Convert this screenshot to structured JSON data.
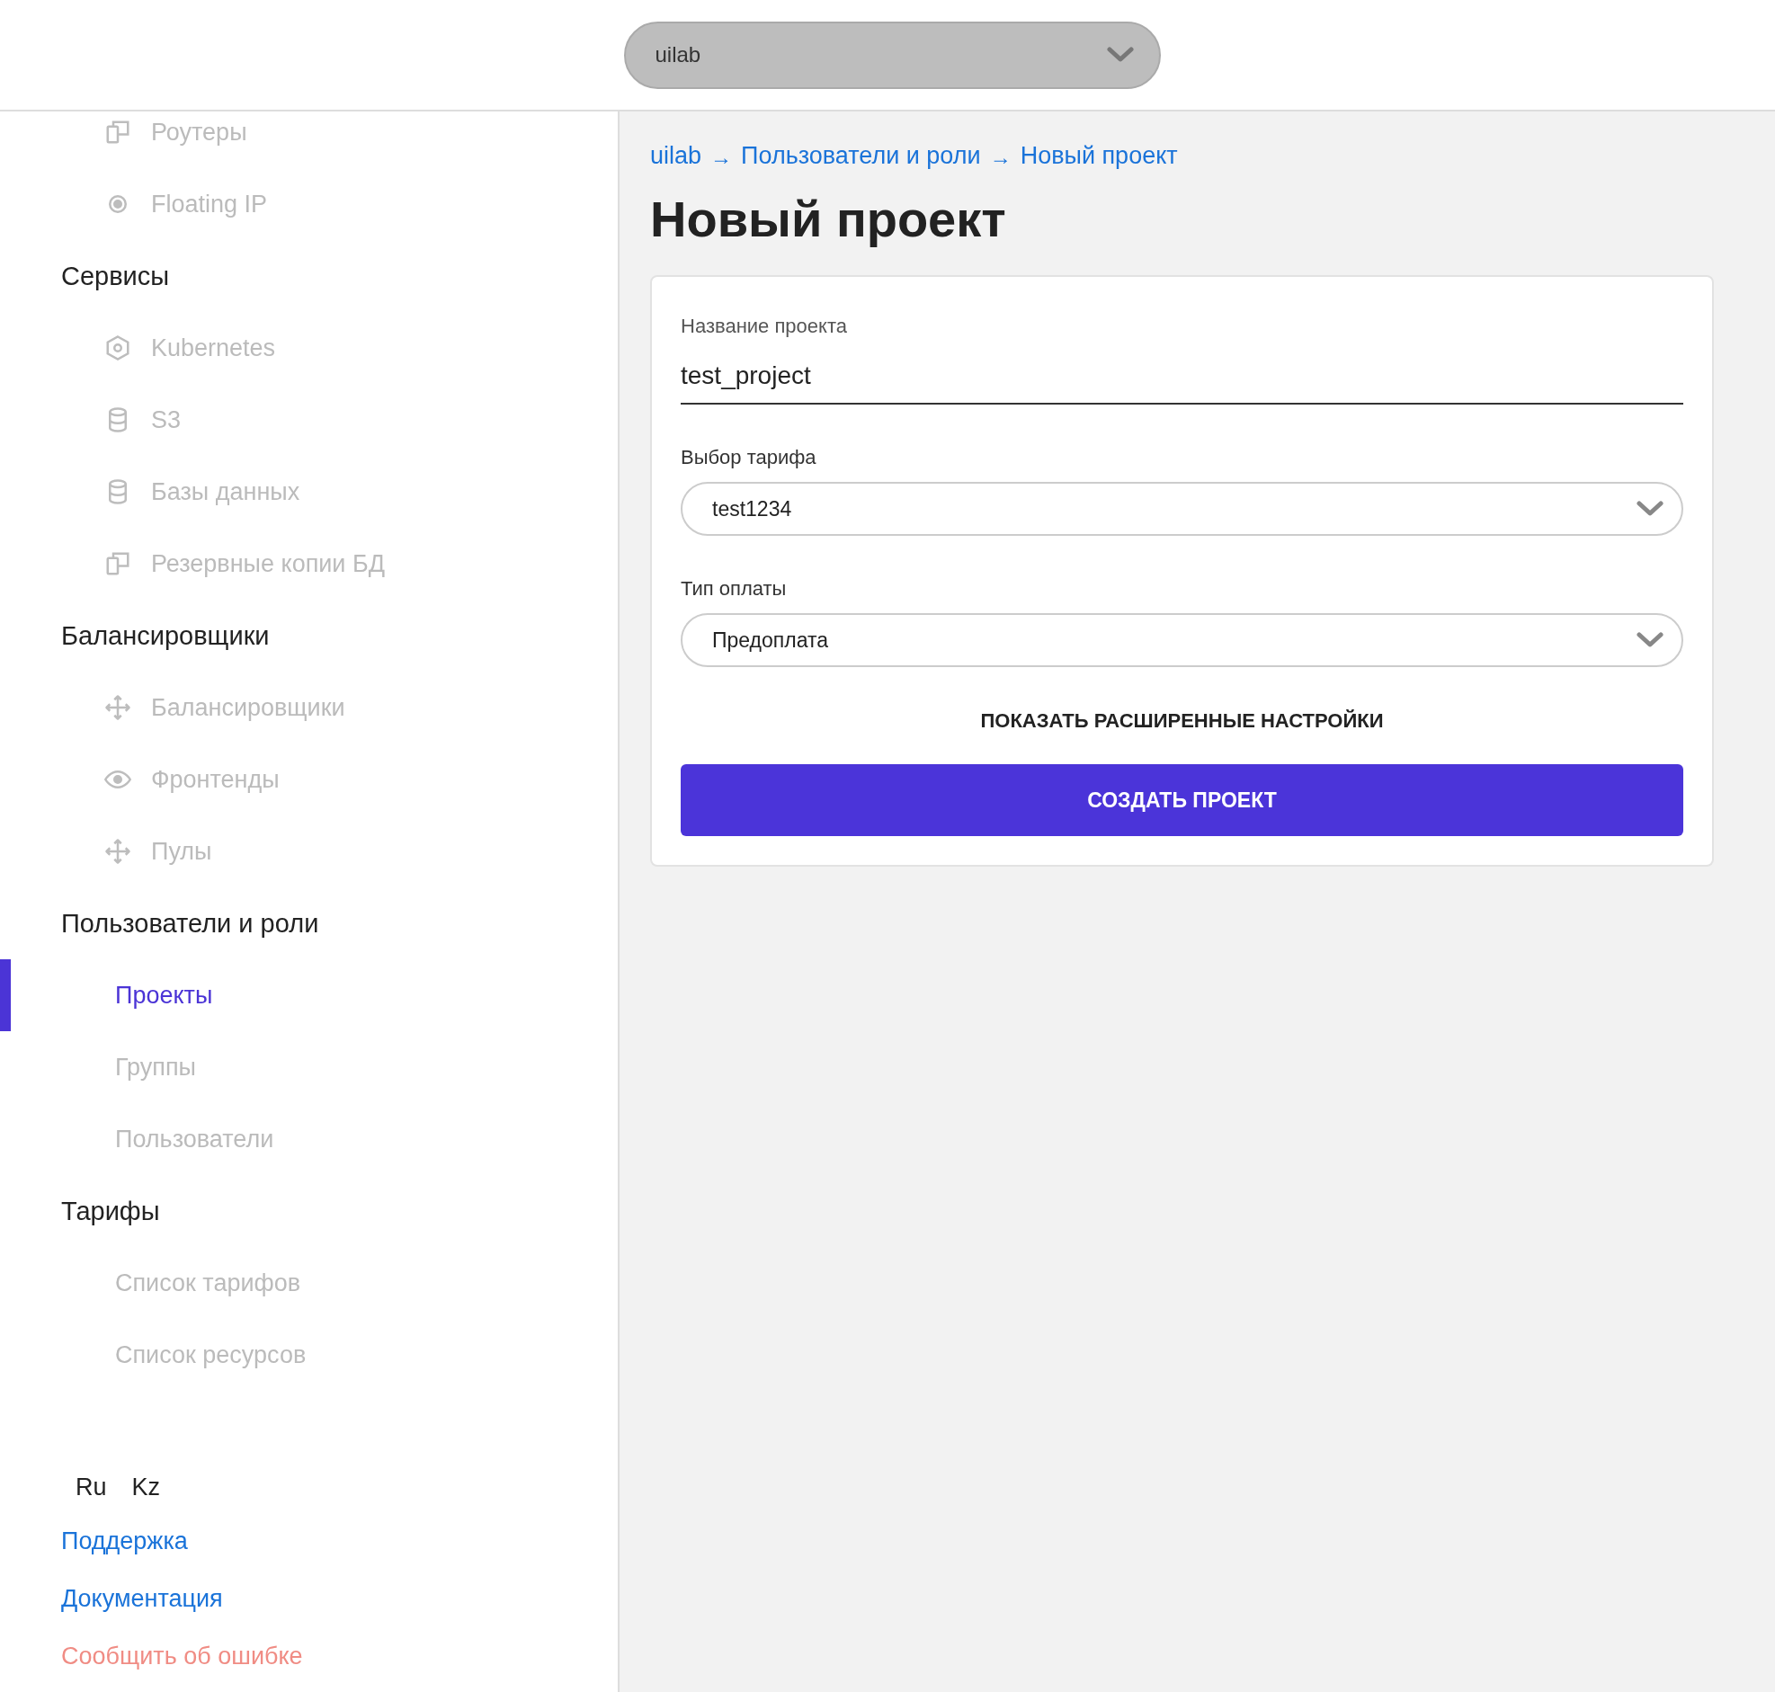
{
  "header": {
    "project_select": {
      "value": "uilab"
    }
  },
  "sidebar": {
    "sections": [
      {
        "items": [
          {
            "label": "Роутеры",
            "kind": "copy",
            "selected": false
          },
          {
            "label": "Floating IP",
            "kind": "target",
            "selected": false
          }
        ]
      },
      {
        "heading": "Сервисы",
        "items": [
          {
            "label": "Kubernetes",
            "kind": "hexagon",
            "selected": false
          },
          {
            "label": "S3",
            "kind": "database",
            "selected": false
          },
          {
            "label": "Базы данных",
            "kind": "database",
            "selected": false
          },
          {
            "label": "Резервные копии БД",
            "kind": "copy",
            "selected": false
          }
        ]
      },
      {
        "heading": "Балансировщики",
        "items": [
          {
            "label": "Балансировщики",
            "kind": "move",
            "selected": false
          },
          {
            "label": "Фронтенды",
            "kind": "eye",
            "selected": false
          },
          {
            "label": "Пулы",
            "kind": "move",
            "selected": false
          }
        ]
      },
      {
        "heading": "Пользователи и роли",
        "items": [
          {
            "label": "Проекты",
            "kind": "plain",
            "selected": true
          },
          {
            "label": "Группы",
            "kind": "plain",
            "selected": false
          },
          {
            "label": "Пользователи",
            "kind": "plain",
            "selected": false
          }
        ]
      },
      {
        "heading": "Тарифы",
        "items": [
          {
            "label": "Список тарифов",
            "kind": "plain",
            "selected": false
          },
          {
            "label": "Список ресурсов",
            "kind": "plain",
            "selected": false
          }
        ]
      }
    ],
    "languages": [
      "Ru",
      "Kz"
    ],
    "links": [
      {
        "label": "Поддержка",
        "color": "#1a73d9"
      },
      {
        "label": "Документация",
        "color": "#1a73d9"
      },
      {
        "label": "Сообщить об ошибке",
        "color": "#f08c84"
      }
    ]
  },
  "breadcrumbs": [
    {
      "kind": "link",
      "label": "uilab"
    },
    {
      "kind": "separator",
      "label": "→"
    },
    {
      "kind": "link",
      "label": "Пользователи и роли"
    },
    {
      "kind": "separator",
      "label": "→"
    },
    {
      "kind": "link",
      "label": "Новый проект"
    }
  ],
  "title": "Новый проект",
  "form": {
    "fields": [
      {
        "kind": "text",
        "label": "Название проекта",
        "value": "test_project"
      },
      {
        "kind": "select",
        "label": "Выбор тарифа",
        "value": "test1234"
      },
      {
        "kind": "select",
        "label": "Тип оплаты",
        "value": "Предоплата"
      }
    ],
    "advanced_toggle": "ПОКАЗАТЬ РАСШИРЕННЫЕ НАСТРОЙКИ",
    "submit": "СОЗДАТЬ ПРОЕКТ"
  }
}
